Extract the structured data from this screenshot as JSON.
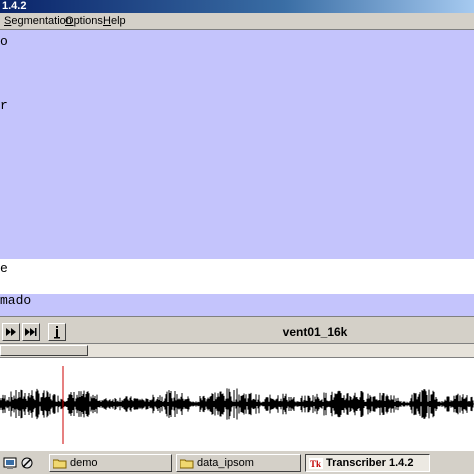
{
  "window": {
    "title": "1.4.2"
  },
  "menu": {
    "items": [
      {
        "label": "Segmentation",
        "underline": "S",
        "rest": "egmentation"
      },
      {
        "label": "Options",
        "underline": "O",
        "rest": "ptions"
      },
      {
        "label": "Help",
        "underline": "H",
        "rest": "elp"
      }
    ]
  },
  "transcript": {
    "line1": "o",
    "line2": "r",
    "line3": "e",
    "line4": "mado"
  },
  "controls": {
    "filename": "vent01_16k"
  },
  "colors": {
    "text_bg": "#c4c4fc",
    "cursor": "#cc0000",
    "waveform": "#000000"
  },
  "taskbar": {
    "buttons": [
      {
        "label": "demo"
      },
      {
        "label": "data_ipsom"
      },
      {
        "label": "Transcriber 1.4.2"
      }
    ]
  }
}
